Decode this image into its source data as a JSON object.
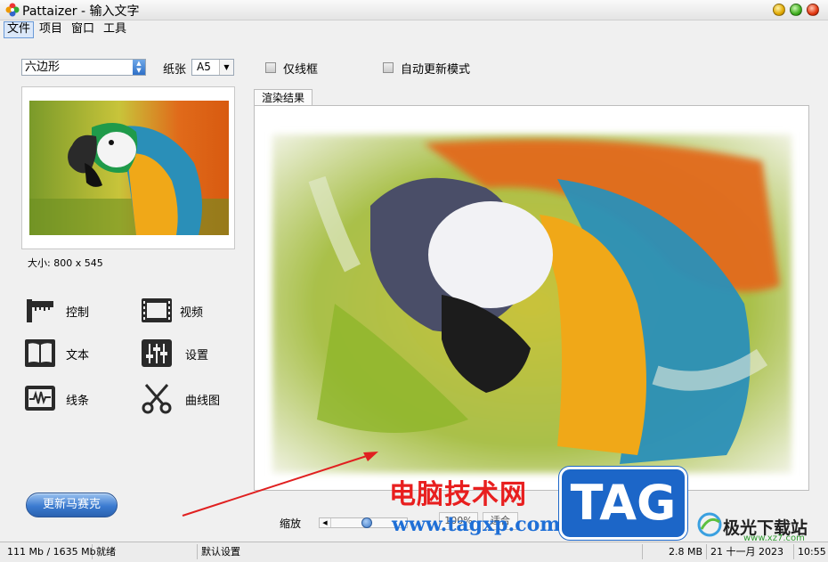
{
  "window": {
    "app_name": "Pattaizer",
    "title": "Pattaizer - 输入文字"
  },
  "menu": [
    "文件",
    "项目",
    "窗口",
    "工具"
  ],
  "left_panel": {
    "shape_select": "六边形",
    "paper_label": "纸张",
    "paper_value": "A5",
    "image_size": "大小: 800 x 545",
    "tools": [
      {
        "label": "控制",
        "icon": "ruler-icon"
      },
      {
        "label": "视频",
        "icon": "film-icon"
      },
      {
        "label": "文本",
        "icon": "book-icon"
      },
      {
        "label": "设置",
        "icon": "sliders-icon"
      },
      {
        "label": "线条",
        "icon": "waveform-icon"
      },
      {
        "label": "曲线图",
        "icon": "scissors-icon"
      }
    ],
    "update_button": "更新马赛克"
  },
  "options": {
    "wireframe_only": "仅线框",
    "auto_update": "自动更新模式"
  },
  "render": {
    "tab_label": "渲染结果"
  },
  "zoom": {
    "label": "缩放",
    "value": "100%",
    "fit_button": "适合"
  },
  "status": {
    "memory": "111 Mb / 1635 Mb",
    "state": "就绪",
    "preset": "默认设置",
    "file_size": "2.8 MB",
    "date": "21 十一月 2023",
    "time": "10:55"
  },
  "watermark": {
    "site_name": "电脑技术网",
    "url": "www.tagxp.com",
    "tag": "TAG",
    "brand": "极光下载站",
    "brand_url": "www.xz7.com"
  },
  "colors": {
    "accent": "#3b7bd0",
    "watermark_red": "#e81f1f",
    "watermark_blue": "#1c66c8"
  }
}
